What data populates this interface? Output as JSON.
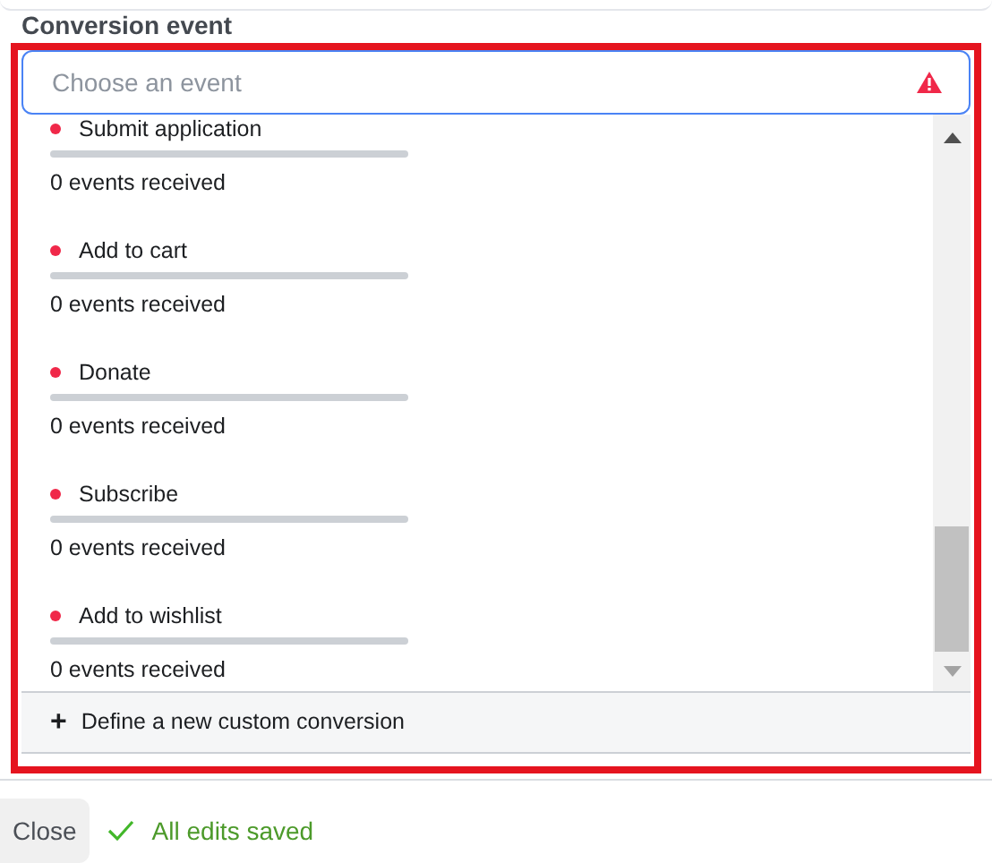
{
  "field_label": "Conversion event",
  "search": {
    "placeholder": "Choose an event",
    "error": true
  },
  "events": [
    {
      "name": "Submit application",
      "color": "#f02849",
      "level": 0,
      "count": "0 events received"
    },
    {
      "name": "Add to cart",
      "color": "#f02849",
      "level": 0,
      "count": "0 events received"
    },
    {
      "name": "Donate",
      "color": "#f02849",
      "level": 0,
      "count": "0 events received"
    },
    {
      "name": "Subscribe",
      "color": "#f02849",
      "level": 0,
      "count": "0 events received"
    },
    {
      "name": "Add to wishlist",
      "color": "#f02849",
      "level": 0,
      "count": "0 events received"
    }
  ],
  "footer_action": {
    "icon": "+",
    "label": "Define a new custom conversion"
  },
  "close_button": "Close",
  "status": "All edits saved"
}
